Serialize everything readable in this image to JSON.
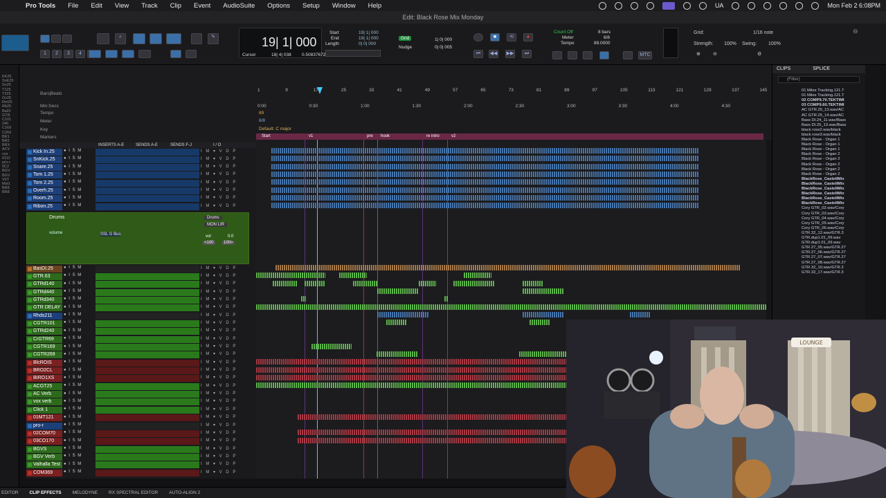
{
  "menubar": {
    "app": "Pro Tools",
    "items": [
      "File",
      "Edit",
      "View",
      "Track",
      "Clip",
      "Event",
      "AudioSuite",
      "Options",
      "Setup",
      "Window",
      "Help"
    ],
    "input_source": "UA",
    "clock": "Mon Feb 2  6:08PM"
  },
  "window": {
    "title": "Edit: Black Rose Mix Monday"
  },
  "toolbar": {
    "counter_main": "19| 1| 000",
    "cursor_label": "Cursor",
    "cursor_value": "18| 4| 038",
    "cursor_extra": "0.50837672",
    "start_label": "Start",
    "end_label": "End",
    "length_label": "Length",
    "start_value": "19| 1| 000",
    "end_value": "19| 1| 000",
    "length_value": "0| 0| 000",
    "grid_label": "Grid",
    "grid_value": "1| 0| 000",
    "nudge_label": "Nudge",
    "nudge_value": "0| 0| 005",
    "count_off": "Count Off",
    "meter": "Meter",
    "tempo": "Tempo",
    "count_bars": "8 bars",
    "meter_value": "6/8",
    "tempo_value": "89.0000",
    "grid_right_label": "Grid:",
    "grid_right_value": "1/16 note",
    "strength_label": "Strength:",
    "strength_value": "100%",
    "swing_label": "Swing:",
    "swing_value": "100%",
    "track_numbers": [
      "1",
      "2",
      "3",
      "4",
      "5"
    ]
  },
  "rulers": {
    "labels": [
      "Bars|Beats",
      "Min:Secs",
      "Tempo",
      "Meter",
      "Key",
      "Markers"
    ],
    "bars": [
      "1",
      "9",
      "17",
      "25",
      "33",
      "41",
      "49",
      "57",
      "65",
      "73",
      "81",
      "89",
      "97",
      "105",
      "113",
      "121",
      "129",
      "137",
      "145"
    ],
    "mins": [
      "0:00",
      "0:30",
      "1:00",
      "1:30",
      "2:00",
      "2:30",
      "3:00",
      "3:30",
      "4:00",
      "4:30"
    ],
    "tempo_value": "89",
    "meter_value": "6/8",
    "key_value": "Default: C major",
    "markers": [
      "Start",
      "v1",
      "pre",
      "hook",
      "re intro",
      "v2"
    ]
  },
  "track_header": {
    "inserts": "INSERTS A-E",
    "sends_ae": "SENDS A-E",
    "sends_fj": "SENDS F-J",
    "io": "I / O"
  },
  "drums_folder": {
    "name": "Drums",
    "output": "Drums",
    "mon": "MON LIR",
    "insert": "SSL G Bus",
    "volume_label": "volume",
    "vol": "vol",
    "vol_value": "0.0",
    "pan_left": "<100",
    "pan_right": "100>"
  },
  "tracks": [
    {
      "name": "Kick In.25",
      "color": "#2a6db5"
    },
    {
      "name": "SnKick.25",
      "color": "#2a6db5"
    },
    {
      "name": "Snare.25",
      "color": "#2a6db5"
    },
    {
      "name": "Tom 1.25",
      "color": "#2a6db5"
    },
    {
      "name": "Tom 2.25",
      "color": "#2a6db5"
    },
    {
      "name": "Overh.25",
      "color": "#2a6db5"
    },
    {
      "name": "Room.25",
      "color": "#2a6db5"
    },
    {
      "name": "Ribon.25",
      "color": "#2a6db5"
    },
    {
      "name": "BasDI.25",
      "color": "#b8702a"
    },
    {
      "name": "GTR.63",
      "color": "#3a9a2a"
    },
    {
      "name": "GTRd140",
      "color": "#3a9a2a"
    },
    {
      "name": "GTRd440",
      "color": "#3a9a2a"
    },
    {
      "name": "GTRd340",
      "color": "#3a9a2a"
    },
    {
      "name": "GTR DELAY",
      "color": "#3a9a2a"
    },
    {
      "name": "Rhds211",
      "color": "#2a6db5"
    },
    {
      "name": "CGTR101",
      "color": "#3a9a2a"
    },
    {
      "name": "GTRd240",
      "color": "#3a9a2a"
    },
    {
      "name": "CrGTR69",
      "color": "#3a9a2a"
    },
    {
      "name": "CGTR169",
      "color": "#3a9a2a"
    },
    {
      "name": "CGTR269",
      "color": "#3a9a2a"
    },
    {
      "name": "BlcROIS",
      "color": "#b8302a"
    },
    {
      "name": "BRO2CL",
      "color": "#b8302a"
    },
    {
      "name": "BIRO1XS",
      "color": "#b8302a"
    },
    {
      "name": "ACGT25",
      "color": "#3a9a2a"
    },
    {
      "name": "AC Verb",
      "color": "#3a9a2a"
    },
    {
      "name": "vox verb",
      "color": "#3a9a2a"
    },
    {
      "name": "Click 1",
      "color": "#3a9a2a"
    },
    {
      "name": "01MT121",
      "color": "#b8302a"
    },
    {
      "name": "pro-r",
      "color": "#2a6db5"
    },
    {
      "name": "02COM70",
      "color": "#b8302a"
    },
    {
      "name": "03CO170",
      "color": "#b8302a"
    },
    {
      "name": "BGVS",
      "color": "#3a9a2a"
    },
    {
      "name": "BGV Verb",
      "color": "#3a9a2a"
    },
    {
      "name": "Valhalla Test",
      "color": "#3a9a2a"
    },
    {
      "name": "COM369",
      "color": "#b8302a"
    }
  ],
  "clips_panel": {
    "tab_clips": "CLIPS",
    "tab_splice": "SPLICE",
    "filter_placeholder": "(Filter)",
    "items": [
      "01 Miles Tracking.121.T",
      "01 Miles Tracking.121.T",
      "02 COMP9.70.TEKTIMI",
      "03 COMP9.60.TEKTIMI",
      "AC GTR.25_13.wav/AC",
      "AC GTR.25_14.wav/AC",
      "Bass DI.24_11.wav/Bass",
      "Bass DI.25_13.wav/Bass",
      "black rose2.wav/black",
      "black rose3.wav/black",
      "Black Rose - Organ 1",
      "Black Rose - Organ 1",
      "Black Rose - Organ 1",
      "Black Rose - Organ 2",
      "Black Rose - Organ 2",
      "Black Rose - Organ 2",
      "Black Rose - Organ 2",
      "Black Rose - Organ 2",
      "BlackRose_CastellMix",
      "BlackRose_CastellMix",
      "BlackRose_CastellMix",
      "BlackRose_CastellMix",
      "BlackRose_CastellMix",
      "BlackRose_CastellMix",
      "Cory GTR_02.wav/Cory",
      "Cory GTR_03.wav/Cory",
      "Cory GTR_04.wav/Cory",
      "Cory GTR_05.wav/Cory",
      "Cory GTR_06.wav/Cory",
      "GTR.32_12.wav/GTR.3",
      "GTR.dup1.01_09.wav",
      "GTR.dup1.01_09.wav",
      "GTR.27_05.wav/GTR.27",
      "GTR.27_06.wav/GTR.27",
      "GTR.27_07.wav/GTR.27",
      "GTR.27_08.wav/GTR.27",
      "GTR.32_10.wav/GTR.3",
      "GTR.32_17.wav/GTR.3"
    ]
  },
  "left_edge_labels": [
    "KK25",
    "SnK25",
    "Sn25",
    "T125",
    "T225",
    "Ov25",
    "Rm25",
    "Rb25",
    "BaDI",
    "GTR",
    "C101",
    "240",
    "C169",
    "C269",
    "BR1",
    "BR2",
    "BRX",
    "ACV",
    "vox",
    "0112",
    "pro-r",
    "0C2",
    "BGV",
    "BGV",
    "VhT",
    "Mst1",
    "BR8",
    "BR8"
  ],
  "bottombar": [
    "EDITOR",
    "CLIP EFFECTS",
    "MELODYNE",
    "RX SPECTRAL EDITOR",
    "AUTO-ALIGN 2"
  ],
  "webcam": {
    "wall_sign": "LOUNGE"
  },
  "colors": {
    "accent": "#3b6fa8",
    "marker_bar": "#6a2846",
    "folder_green": "#2f5a17"
  }
}
